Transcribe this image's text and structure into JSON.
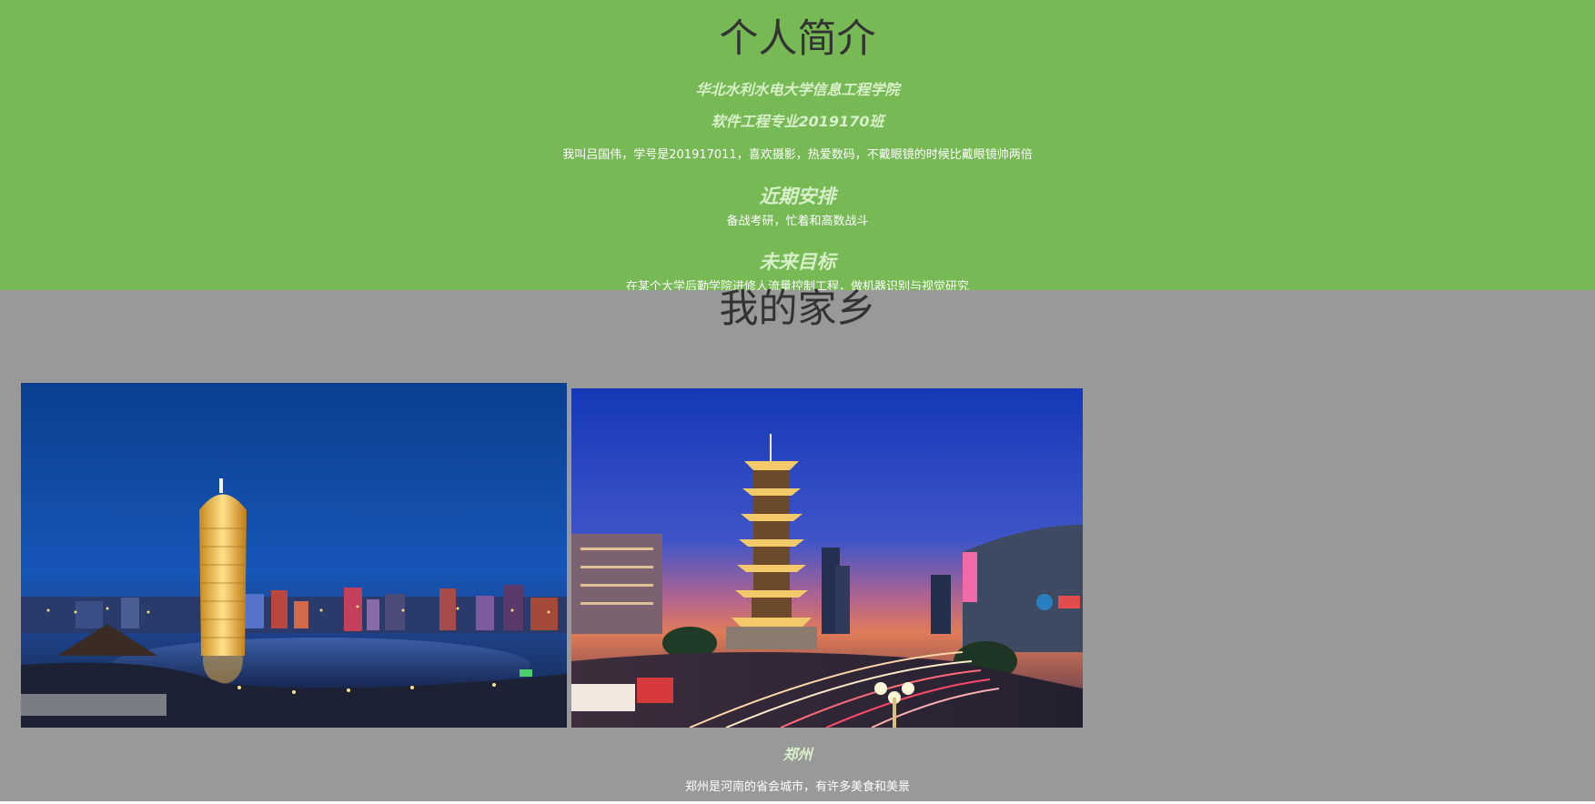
{
  "intro": {
    "title": "个人简介",
    "school": "华北水利水电大学信息工程学院",
    "class_name": "软件工程专业2019170班",
    "bio": "我叫吕国伟，学号是201917011，喜欢摄影，热爱数码，不戴眼镜的时候比戴眼镜帅两倍",
    "plan_heading": "近期安排",
    "plan_text": "备战考研，忙着和高数战斗",
    "goal_heading": "未来目标",
    "goal_text": "在某个大学后勤学院进修人流量控制工程，做机器识别与视觉研究"
  },
  "home": {
    "title": "我的家乡",
    "city": "郑州",
    "city_text": "郑州是河南的省会城市，有许多美食和美景"
  },
  "colors": {
    "intro_bg": "#77b955",
    "home_bg": "#999999",
    "heading_text": "#333333",
    "accent_text": "#d8f0c9"
  }
}
